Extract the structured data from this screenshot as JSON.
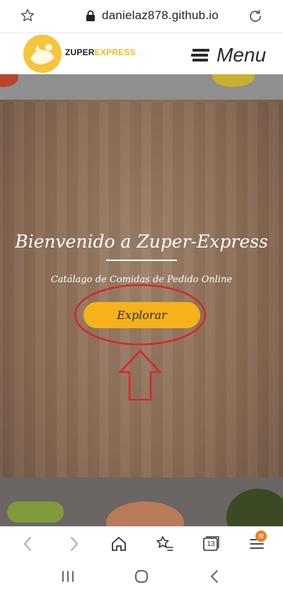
{
  "browser": {
    "url": "danielaz878.github.io",
    "tabs_count": "13",
    "notification_badge": "N"
  },
  "site": {
    "logo": {
      "name_part1": "ZUPER",
      "name_part2": "EXPRESS"
    },
    "menu_label": "Menu"
  },
  "hero": {
    "title": "Bienvenido a Zuper-Express",
    "subtitle": "Catálago de Comidas de Pedido Online",
    "button_label": "Explorar"
  },
  "icons": {
    "bookmark": "star-icon",
    "secure": "lock-icon",
    "reload": "reload-icon",
    "menu": "hamburger-icon",
    "back": "chevron-left-icon",
    "forward": "chevron-right-icon",
    "home": "home-icon",
    "bookmarks": "star-list-icon",
    "tabs": "tabs-icon",
    "browser_menu": "hamburger-icon",
    "recents": "recents-icon",
    "android_home": "android-home-icon",
    "android_back": "android-back-icon"
  },
  "colors": {
    "accent": "#f6b21b",
    "annotation": "#d42a2a"
  }
}
